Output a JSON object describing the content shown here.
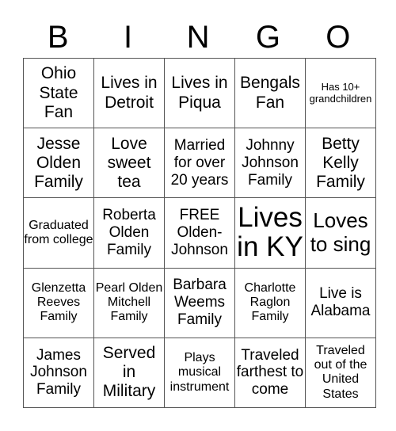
{
  "header": {
    "letters": [
      "B",
      "I",
      "N",
      "G",
      "O"
    ]
  },
  "card": {
    "rows": [
      [
        {
          "text": "Ohio State Fan",
          "size": "lg"
        },
        {
          "text": "Lives in Detroit",
          "size": "lg"
        },
        {
          "text": "Lives in Piqua",
          "size": "lg"
        },
        {
          "text": "Bengals Fan",
          "size": "lg"
        },
        {
          "text": "Has 10+ grandchildren",
          "size": "xs"
        }
      ],
      [
        {
          "text": "Jesse Olden Family",
          "size": "lg"
        },
        {
          "text": "Love sweet tea",
          "size": "lg"
        },
        {
          "text": "Married for over 20 years",
          "size": "md"
        },
        {
          "text": "Johnny Johnson Family",
          "size": "md"
        },
        {
          "text": "Betty Kelly Family",
          "size": "lg"
        }
      ],
      [
        {
          "text": "Graduated from college",
          "size": "sm"
        },
        {
          "text": "Roberta Olden Family",
          "size": "md"
        },
        {
          "text": "FREE Olden-Johnson",
          "size": "md",
          "free": true
        },
        {
          "text": "Lives in KY",
          "size": "xxl"
        },
        {
          "text": "Loves to sing",
          "size": "xl"
        }
      ],
      [
        {
          "text": "Glenzetta Reeves Family",
          "size": "sm"
        },
        {
          "text": "Pearl Olden Mitchell Family",
          "size": "sm"
        },
        {
          "text": "Barbara Weems Family",
          "size": "md"
        },
        {
          "text": "Charlotte Raglon Family",
          "size": "sm"
        },
        {
          "text": "Live is Alabama",
          "size": "md"
        }
      ],
      [
        {
          "text": "James Johnson Family",
          "size": "md"
        },
        {
          "text": "Served in Military",
          "size": "lg"
        },
        {
          "text": "Plays musical instrument",
          "size": "sm"
        },
        {
          "text": "Traveled farthest to come",
          "size": "md"
        },
        {
          "text": "Traveled out of the United States",
          "size": "sm"
        }
      ]
    ]
  }
}
